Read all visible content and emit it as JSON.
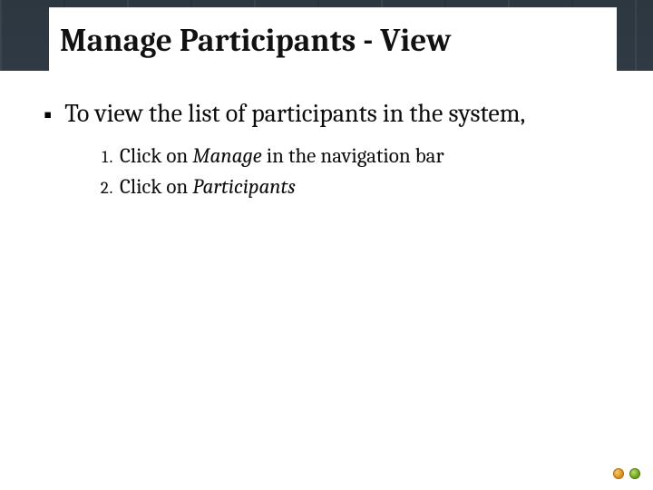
{
  "header": {
    "title": "Manage Participants - View"
  },
  "content": {
    "bullet_lead": "To view the list of participants in the system,",
    "steps": [
      {
        "prefix": "Click on ",
        "em": "Manage",
        "suffix": " in the navigation bar"
      },
      {
        "prefix": "Click on ",
        "em": "Participants",
        "suffix": ""
      }
    ]
  },
  "pager": {
    "prev_icon": "circle-left-icon",
    "next_icon": "circle-right-icon"
  }
}
